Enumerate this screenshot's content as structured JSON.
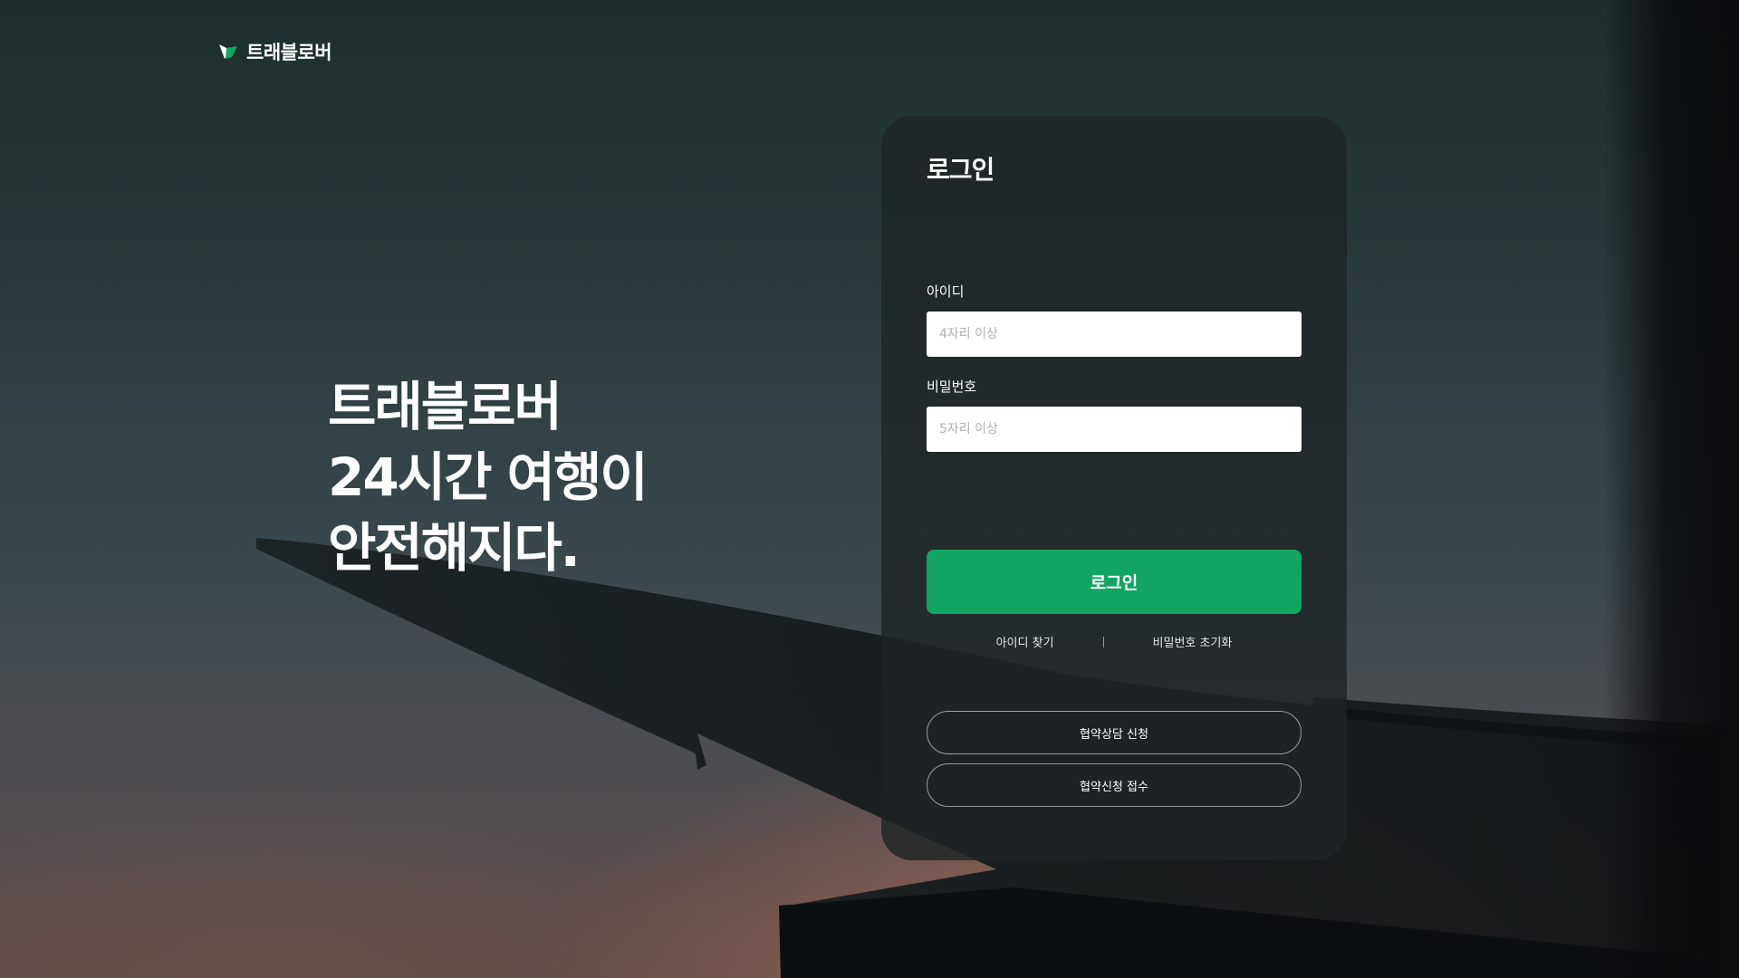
{
  "brand": {
    "name": "트래블로버",
    "logo_icon": "leaf-logo-icon",
    "accent_color": "#11a561"
  },
  "hero": {
    "lines": [
      "트래블로버",
      "24시간 여행이",
      "안전해지다."
    ]
  },
  "login": {
    "title": "로그인",
    "id_label": "아이디",
    "id_placeholder": "4자리 이상",
    "id_value": "",
    "password_label": "비밀번호",
    "password_placeholder": "5자리 이상",
    "password_value": "",
    "submit_label": "로그인",
    "find_id_label": "아이디 찾기",
    "reset_password_label": "비밀번호 초기화",
    "consult_request_label": "협약상담 신청",
    "application_receipt_label": "협약신청 접수"
  }
}
